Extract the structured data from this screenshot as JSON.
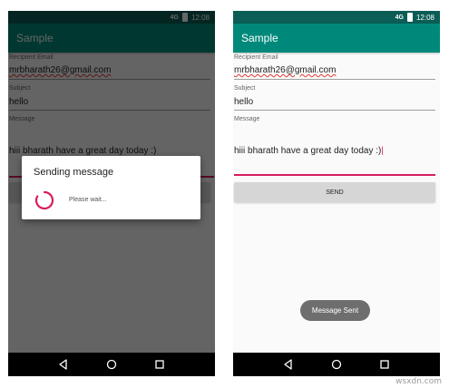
{
  "status_bar": {
    "signal": "4G",
    "time": "12:08"
  },
  "app": {
    "title": "Sample"
  },
  "form": {
    "email_label": "Recipient Email",
    "email_value": "mrbharath26@gmail.com",
    "subject_label": "Subject",
    "subject_value": "hello",
    "message_label": "Message",
    "message_value": "hiii bharath have a great day today :)",
    "send_label": "SEND"
  },
  "dialog": {
    "title": "Sending message",
    "message": "Please wait..."
  },
  "toast": {
    "text": "Message Sent"
  },
  "nav": {
    "back": "back-icon",
    "home": "home-icon",
    "recents": "recents-icon"
  },
  "watermark": "wsxdn.com",
  "colors": {
    "primary": "#00897b",
    "primary_dark": "#0b5d55",
    "accent": "#d81b60"
  }
}
